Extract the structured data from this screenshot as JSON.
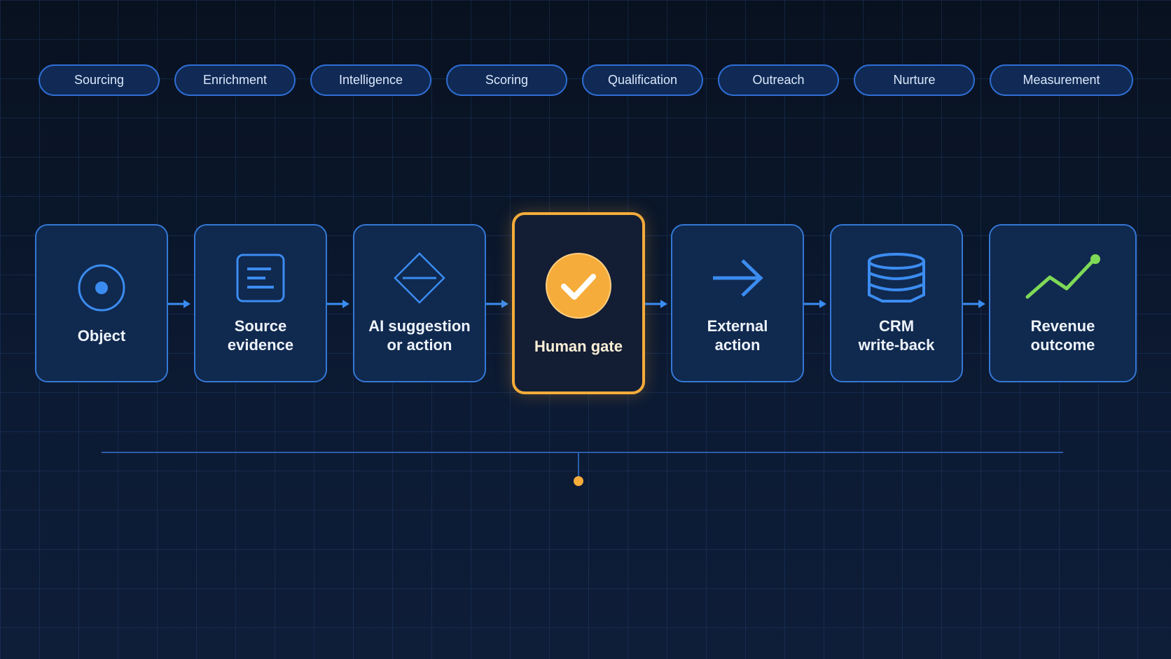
{
  "stages": [
    "Sourcing",
    "Enrichment",
    "Intelligence",
    "Scoring",
    "Qualification",
    "Outreach",
    "Nurture",
    "Measurement"
  ],
  "flow": [
    {
      "label": "Object",
      "icon": "target-icon"
    },
    {
      "label": "Source\nevidence",
      "icon": "document-lines-icon"
    },
    {
      "label": "AI suggestion\nor action",
      "icon": "diamond-icon"
    },
    {
      "label": "Human gate",
      "icon": "checkmark-circle-icon"
    },
    {
      "label": "External\naction",
      "icon": "arrow-right-icon"
    },
    {
      "label": "CRM\nwrite-back",
      "icon": "database-icon"
    },
    {
      "label": "Revenue\noutcome",
      "icon": "trend-up-icon"
    }
  ],
  "colors": {
    "accent": "#f5ac3a",
    "primary": "#3b8cf0",
    "positive": "#7ed957",
    "card": "#10294f",
    "background": "#0b162b"
  }
}
